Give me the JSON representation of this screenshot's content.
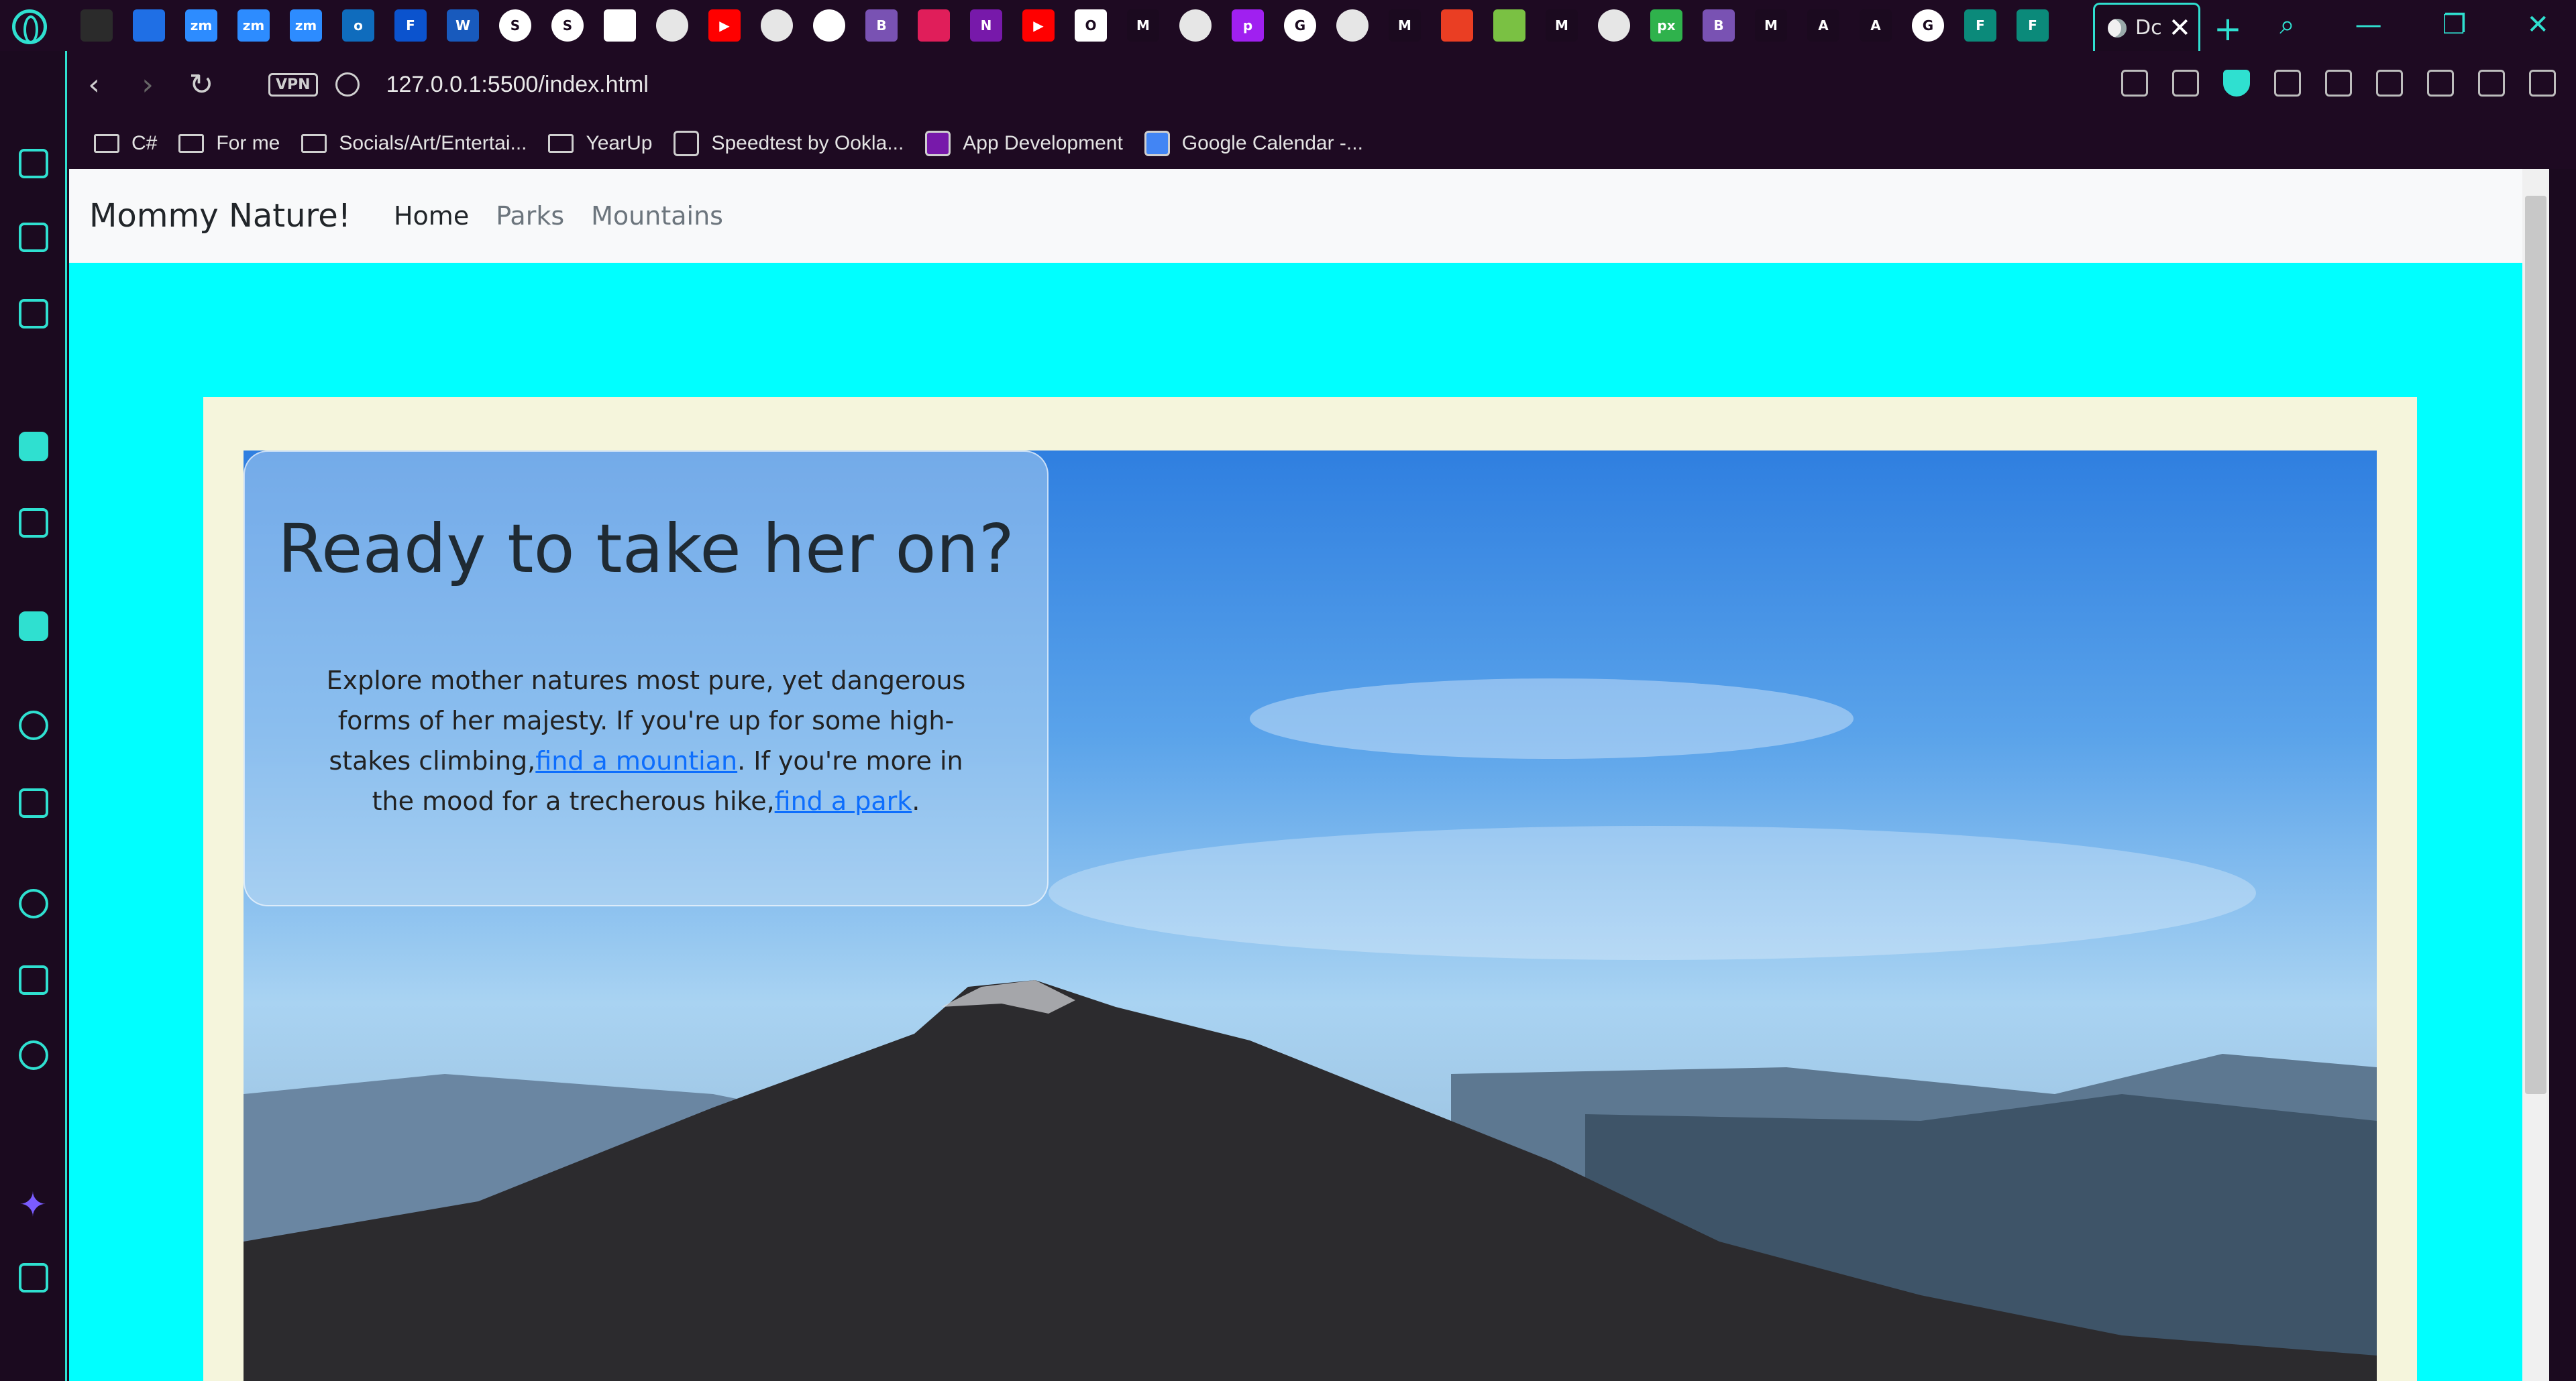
{
  "browser": {
    "active_tab_title": "Dc",
    "url": "127.0.0.1:5500/index.html",
    "vpn_label": "VPN",
    "tab_icons": [
      {
        "name": "gamepad-icon",
        "color": "#2b2b2b",
        "label": ""
      },
      {
        "name": "windows-icon",
        "color": "#1f6fe5",
        "label": ""
      },
      {
        "name": "zoom-icon",
        "color": "#2d8cff",
        "label": "zm"
      },
      {
        "name": "zoom-icon",
        "color": "#2d8cff",
        "label": "zm"
      },
      {
        "name": "zoom-icon",
        "color": "#2d8cff",
        "label": "zm"
      },
      {
        "name": "outlook-icon",
        "color": "#0f6cbd",
        "label": "o"
      },
      {
        "name": "forms-icon",
        "color": "#0b53ce",
        "label": "F"
      },
      {
        "name": "word-icon",
        "color": "#185abd",
        "label": "W"
      },
      {
        "name": "skype-icon",
        "color": "#ffffff",
        "label": "S"
      },
      {
        "name": "skype-icon",
        "color": "#ffffff",
        "label": "S"
      },
      {
        "name": "unsplash-icon",
        "color": "#ffffff",
        "label": ""
      },
      {
        "name": "globe-icon",
        "color": "#e6e6e6",
        "label": ""
      },
      {
        "name": "youtube-icon",
        "color": "#ff0000",
        "label": "▶"
      },
      {
        "name": "globe-icon",
        "color": "#e6e6e6",
        "label": ""
      },
      {
        "name": "github-icon",
        "color": "#ffffff",
        "label": ""
      },
      {
        "name": "bootstrap-icon",
        "color": "#7952b3",
        "label": "B"
      },
      {
        "name": "slack-icon",
        "color": "#e01e5a",
        "label": ""
      },
      {
        "name": "onenote-icon",
        "color": "#7719aa",
        "label": "N"
      },
      {
        "name": "youtube-icon",
        "color": "#ff0000",
        "label": "▶"
      },
      {
        "name": "notion-icon",
        "color": "#ffffff",
        "label": "O"
      },
      {
        "name": "medium-icon",
        "color": "#1b0a1f",
        "label": "M"
      },
      {
        "name": "globe-icon",
        "color": "#e6e6e6",
        "label": ""
      },
      {
        "name": "phpstorm-icon",
        "color": "#a020f0",
        "label": "p"
      },
      {
        "name": "google-icon",
        "color": "#ffffff",
        "label": "G"
      },
      {
        "name": "globe-icon",
        "color": "#e6e6e6",
        "label": ""
      },
      {
        "name": "medium-icon",
        "color": "#1b0a1f",
        "label": "M"
      },
      {
        "name": "office-icon",
        "color": "#ea3e23",
        "label": ""
      },
      {
        "name": "bluestacks-icon",
        "color": "#7ac143",
        "label": ""
      },
      {
        "name": "medium-icon",
        "color": "#1b0a1f",
        "label": "M"
      },
      {
        "name": "globe-icon",
        "color": "#e6e6e6",
        "label": ""
      },
      {
        "name": "pixlr-icon",
        "color": "#2fb24c",
        "label": "px"
      },
      {
        "name": "bootstrap-icon",
        "color": "#7952b3",
        "label": "B"
      },
      {
        "name": "medium-icon",
        "color": "#1b0a1f",
        "label": "M"
      },
      {
        "name": "angular-icon",
        "color": "#1b0a1f",
        "label": "A"
      },
      {
        "name": "angular-icon",
        "color": "#1b0a1f",
        "label": "A"
      },
      {
        "name": "google-icon",
        "color": "#ffffff",
        "label": "G"
      },
      {
        "name": "forms-icon",
        "color": "#0b8a7a",
        "label": "F"
      },
      {
        "name": "forms-icon",
        "color": "#0b8a7a",
        "label": "F"
      }
    ],
    "bookmarks": [
      {
        "name": "bookmark-csharp",
        "label": "C#",
        "icon": "folder-icon"
      },
      {
        "name": "bookmark-for-me",
        "label": "For me",
        "icon": "folder-icon"
      },
      {
        "name": "bookmark-socials",
        "label": "Socials/Art/Entertai...",
        "icon": "folder-icon"
      },
      {
        "name": "bookmark-yearup",
        "label": "YearUp",
        "icon": "folder-icon"
      },
      {
        "name": "bookmark-speedtest",
        "label": "Speedtest by Ookla...",
        "icon": "speedometer-icon"
      },
      {
        "name": "bookmark-app-dev",
        "label": "App Development",
        "icon": "onenote-icon"
      },
      {
        "name": "bookmark-google-calendar",
        "label": "Google Calendar -...",
        "icon": "calendar-icon"
      }
    ],
    "colors": {
      "accent": "#2fe0d0",
      "chrome_bg": "#1e0a22"
    }
  },
  "site": {
    "brand": "Mommy Nature!",
    "nav": [
      "Home",
      "Parks",
      "Mountains"
    ],
    "hero": {
      "title": "Ready to take her on?",
      "text_before": "Explore mother natures most pure, yet dangerous forms of her majesty. If you're up for some high-stakes climbing,",
      "link_mountain": "find a mountian",
      "text_middle": ". If you're more in the mood for a trecherous hike,",
      "link_park": "find a park",
      "text_after": "."
    },
    "colors": {
      "page_bg": "#00ffff",
      "frame_bg": "#f5f5dc",
      "link": "#0d6efd"
    }
  }
}
